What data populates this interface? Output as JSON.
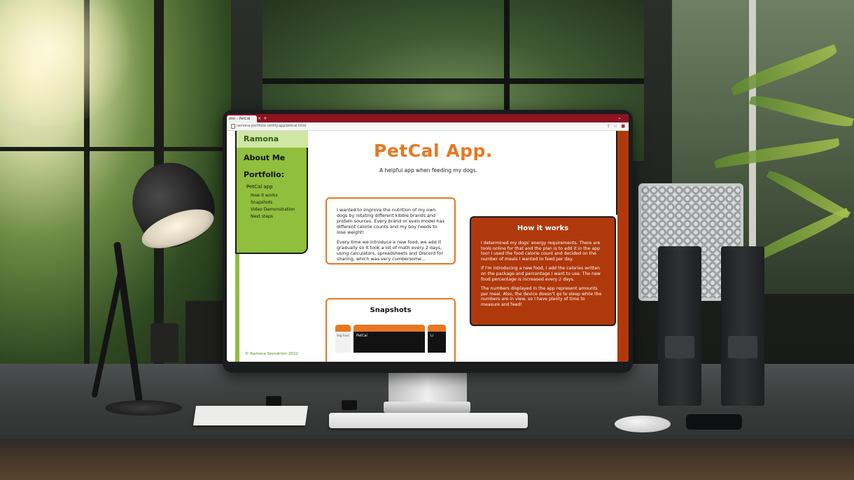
{
  "browser": {
    "tab_title": "olio – PetCal",
    "tab_close": "×",
    "tab_new": "+",
    "url": "ramona-portfolio.netlify.app/petcal.html"
  },
  "sidebar": {
    "logo": "Ramona",
    "about": "About Me",
    "portfolio": "Portfolio:",
    "project": "PetCal app",
    "subitems": [
      "How it works",
      "Snapshots",
      "Video Demonstration",
      "Next steps"
    ]
  },
  "page": {
    "title": "PetCal App.",
    "subtitle": "A helpful app when feeding my dogs.",
    "intro": {
      "p1": "I wanted to improve the nutrition of my own dogs by rotating different kibble brands and protein sources. Every brand or even model has different calorie counts and my boy needs to lose weight!",
      "p2": "Every time we introduce a new food, we add it gradually so it took a lot of math every 2 days, using calculators, spreadsheets and Discord for sharing, which was very cumbersome..."
    },
    "how_it_works": {
      "heading": "How it works",
      "p1": "I determined my dogs' energy requirements. There are tools online for that and the plan is to add it in the app too! I used the food calorie count and decided on the number of meals I wanted to feed per day.",
      "p2": "If I'm introducing a new food, I add the calories written on the package and percentage I want to use. The new food percentage is increased every 2 days.",
      "p3": "The numbers displayed in the app represent amounts per meal. Also, the device doesn't go to sleep while the numbers are in view, so I have plenty of time to measure and feed!"
    },
    "snapshots": {
      "heading": "Snapshots",
      "shot_labels": [
        "dog food",
        "PetCal",
        "Li"
      ]
    },
    "footer": "© Ramona Stenström 2022"
  },
  "colors": {
    "accent_orange": "#e87722",
    "brand_green": "#8fbf3c",
    "dark_orange": "#b0390b",
    "tab_bar": "#8a1420"
  }
}
